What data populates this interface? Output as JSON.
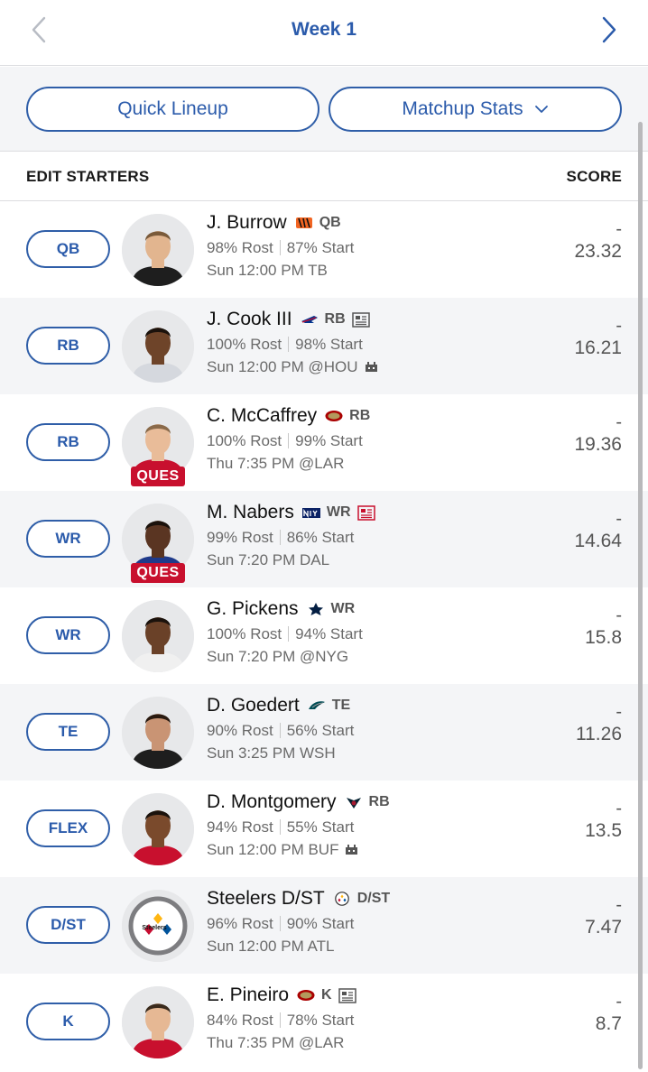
{
  "header": {
    "week_title": "Week 1",
    "prev_icon": "chevron-left-icon",
    "next_icon": "chevron-right-icon"
  },
  "toolbar": {
    "quick_lineup": "Quick Lineup",
    "matchup_stats": "Matchup Stats",
    "dropdown_icon": "chevron-down-icon"
  },
  "list_header": {
    "left": "EDIT STARTERS",
    "right": "SCORE"
  },
  "colors": {
    "accent": "#2b5bab",
    "injury_badge": "#c8102e",
    "alt_row": "#f4f5f7"
  },
  "players": [
    {
      "slot": "QB",
      "name": "J. Burrow",
      "team_logo": "bengals-logo",
      "pos": "QB",
      "news": false,
      "rost": "98% Rost",
      "start": "87% Start",
      "game": "Sun 12:00 PM TB",
      "venue_icon": false,
      "status": "",
      "proj": "-",
      "score": "23.32"
    },
    {
      "slot": "RB",
      "name": "J. Cook III",
      "team_logo": "bills-logo",
      "pos": "RB",
      "news": true,
      "news_alert": false,
      "rost": "100% Rost",
      "start": "98% Start",
      "game": "Sun 12:00 PM @HOU",
      "venue_icon": true,
      "status": "",
      "proj": "-",
      "score": "16.21"
    },
    {
      "slot": "RB",
      "name": "C. McCaffrey",
      "team_logo": "49ers-logo",
      "pos": "RB",
      "news": false,
      "rost": "100% Rost",
      "start": "99% Start",
      "game": "Thu 7:35 PM @LAR",
      "venue_icon": false,
      "status": "QUES",
      "proj": "-",
      "score": "19.36"
    },
    {
      "slot": "WR",
      "name": "M. Nabers",
      "team_logo": "giants-logo",
      "pos": "WR",
      "news": true,
      "news_alert": true,
      "rost": "99% Rost",
      "start": "86% Start",
      "game": "Sun 7:20 PM DAL",
      "venue_icon": false,
      "status": "QUES",
      "proj": "-",
      "score": "14.64"
    },
    {
      "slot": "WR",
      "name": "G. Pickens",
      "team_logo": "cowboys-logo",
      "pos": "WR",
      "news": false,
      "rost": "100% Rost",
      "start": "94% Start",
      "game": "Sun 7:20 PM @NYG",
      "venue_icon": false,
      "status": "",
      "proj": "-",
      "score": "15.8"
    },
    {
      "slot": "TE",
      "name": "D. Goedert",
      "team_logo": "eagles-logo",
      "pos": "TE",
      "news": false,
      "rost": "90% Rost",
      "start": "56% Start",
      "game": "Sun 3:25 PM WSH",
      "venue_icon": false,
      "status": "",
      "proj": "-",
      "score": "11.26"
    },
    {
      "slot": "FLEX",
      "name": "D. Montgomery",
      "team_logo": "texans-logo",
      "pos": "RB",
      "news": false,
      "rost": "94% Rost",
      "start": "55% Start",
      "game": "Sun 12:00 PM BUF",
      "venue_icon": true,
      "status": "",
      "proj": "-",
      "score": "13.5"
    },
    {
      "slot": "D/ST",
      "name": "Steelers D/ST",
      "team_logo": "steelers-logo",
      "pos": "D/ST",
      "news": false,
      "rost": "96% Rost",
      "start": "90% Start",
      "game": "Sun 12:00 PM ATL",
      "venue_icon": false,
      "status": "",
      "proj": "-",
      "score": "7.47",
      "avatar_text": "Steelers"
    },
    {
      "slot": "K",
      "name": "E. Pineiro",
      "team_logo": "49ers-logo",
      "pos": "K",
      "news": true,
      "news_alert": false,
      "rost": "84% Rost",
      "start": "78% Start",
      "game": "Thu 7:35 PM @LAR",
      "venue_icon": false,
      "status": "",
      "proj": "-",
      "score": "8.7"
    }
  ]
}
